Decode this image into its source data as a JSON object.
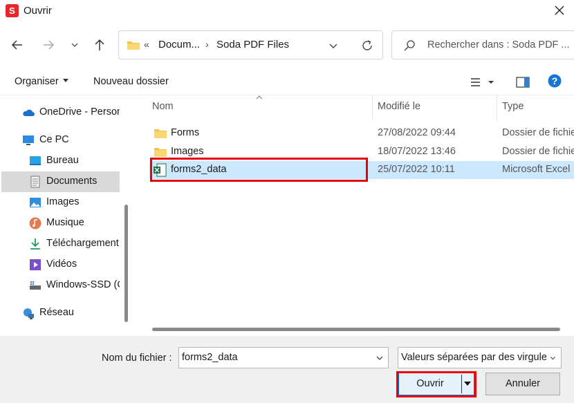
{
  "window": {
    "app_icon_letter": "S",
    "title": "Ouvrir",
    "close_glyph": "✕",
    "icons": {
      "app": "soda-pdf-icon",
      "close": "close-icon"
    }
  },
  "navigation": {
    "back_icon": "arrow-left-icon",
    "forward_icon": "arrow-right-icon",
    "recent_icon": "chevron-down-icon",
    "up_icon": "arrow-up-icon",
    "address": {
      "overflow": "«",
      "crumb_1": "Docum...",
      "separator": "›",
      "crumb_2": "Soda PDF Files"
    },
    "search_placeholder": "Rechercher dans : Soda PDF ..."
  },
  "toolbar": {
    "organise": "Organiser",
    "new_folder": "Nouveau dossier",
    "view_icon": "view-options-icon",
    "preview_icon": "preview-pane-icon",
    "help_icon": "help-icon",
    "help_glyph": "?"
  },
  "sidebar": {
    "items": [
      {
        "label": "OneDrive - Person",
        "icon": "cloud-icon"
      },
      {
        "label": "Ce PC",
        "icon": "computer-icon"
      },
      {
        "label": "Bureau",
        "icon": "desktop-icon"
      },
      {
        "label": "Documents",
        "icon": "documents-icon",
        "selected": true
      },
      {
        "label": "Images",
        "icon": "pictures-icon"
      },
      {
        "label": "Musique",
        "icon": "music-icon"
      },
      {
        "label": "Téléchargement",
        "icon": "download-icon"
      },
      {
        "label": "Vidéos",
        "icon": "video-icon"
      },
      {
        "label": "Windows-SSD (C",
        "icon": "drive-icon"
      },
      {
        "label": "Réseau",
        "icon": "network-icon"
      }
    ]
  },
  "files": {
    "columns": {
      "name": "Nom",
      "modified": "Modifié le",
      "type": "Type"
    },
    "rows": [
      {
        "name": "Forms",
        "modified": "27/08/2022 09:44",
        "type": "Dossier de fichie",
        "icon": "folder-icon"
      },
      {
        "name": "Images",
        "modified": "18/07/2022 13:46",
        "type": "Dossier de fichie",
        "icon": "folder-icon"
      },
      {
        "name": "forms2_data",
        "modified": "25/07/2022 10:11",
        "type": "Microsoft Excel",
        "icon": "excel-file-icon",
        "selected": true
      }
    ]
  },
  "footer": {
    "filename_label": "Nom du fichier :",
    "filename_value": "forms2_data",
    "filetype_value": "Valeurs séparées par des virgules",
    "open_button": "Ouvrir",
    "cancel_button": "Annuler"
  },
  "colors": {
    "highlight": "#e8000b",
    "selection": "#cce8ff",
    "sidebar_selection": "#d9d9d9",
    "accent": "#0078d7"
  }
}
